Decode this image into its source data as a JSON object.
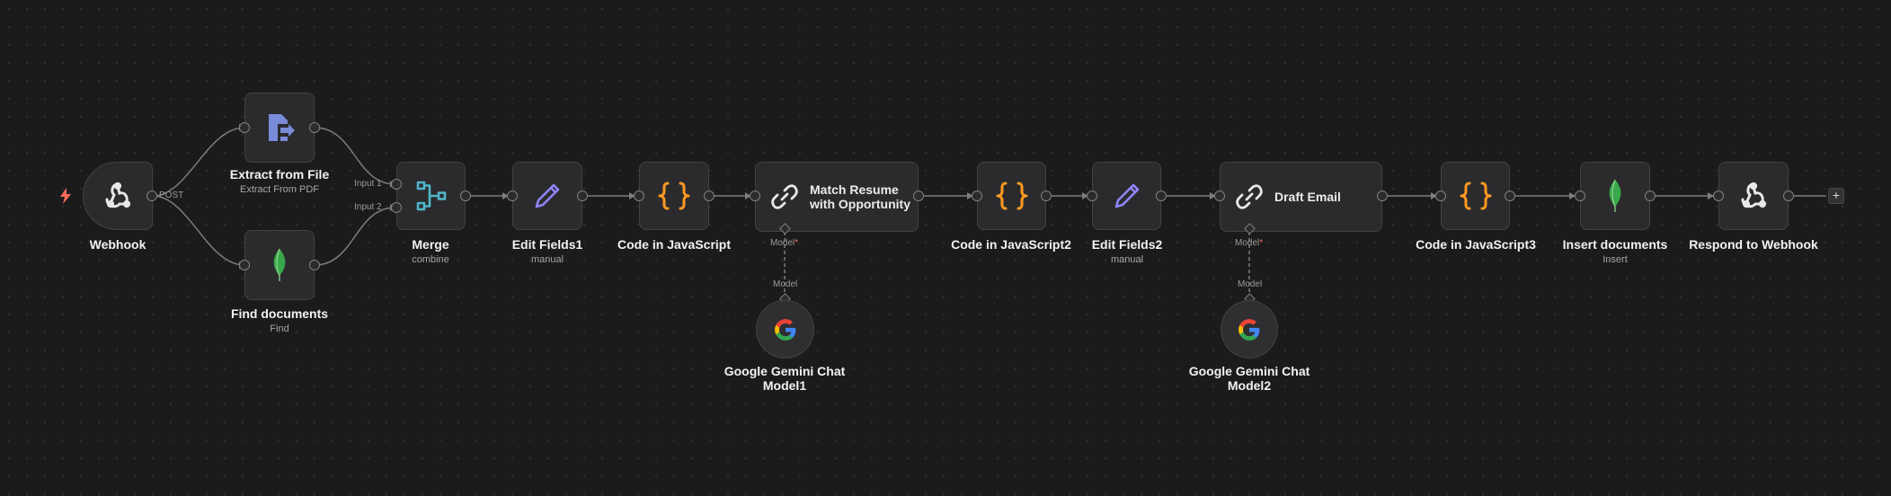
{
  "colors": {
    "background": "#1b1b1c",
    "node_fill": "#2b2b2d",
    "node_border": "#424244",
    "edge": "#7d7d80",
    "code_icon": "#ff9922",
    "edit_icon": "#8f86ff",
    "merge_icon": "#4fb6c9",
    "extract_icon": "#7a8bd9",
    "trigger_bolt": "#ff6d5a",
    "required_asterisk": "#ff6d6d"
  },
  "workflow": {
    "nodes": {
      "webhook": {
        "title": "Webhook",
        "icon": "webhook-icon"
      },
      "extract": {
        "title": "Extract from File",
        "subtitle": "Extract From PDF",
        "icon": "extract-file-icon"
      },
      "find": {
        "title": "Find documents",
        "subtitle": "Find",
        "icon": "mongodb-leaf-icon"
      },
      "merge": {
        "title": "Merge",
        "subtitle": "combine",
        "icon": "merge-icon"
      },
      "edit1": {
        "title": "Edit Fields1",
        "subtitle": "manual",
        "icon": "pencil-icon"
      },
      "code1": {
        "title": "Code in JavaScript",
        "icon": "code-braces-icon"
      },
      "match": {
        "title": "Match Resume\nwith Opportunity",
        "icon": "link-icon"
      },
      "gemini1": {
        "title": "Google Gemini Chat\nModel1",
        "icon": "google-g-icon"
      },
      "code2": {
        "title": "Code in JavaScript2",
        "icon": "code-braces-icon"
      },
      "edit2": {
        "title": "Edit Fields2",
        "subtitle": "manual",
        "icon": "pencil-icon"
      },
      "draft": {
        "title": "Draft Email",
        "icon": "link-icon"
      },
      "gemini2": {
        "title": "Google Gemini Chat\nModel2",
        "icon": "google-g-icon"
      },
      "code3": {
        "title": "Code in JavaScript3",
        "icon": "code-braces-icon"
      },
      "insert": {
        "title": "Insert documents",
        "subtitle": "Insert",
        "icon": "mongodb-leaf-icon"
      },
      "respond": {
        "title": "Respond to Webhook",
        "icon": "webhook-icon"
      }
    },
    "labels": {
      "post": "POST",
      "input1": "Input 1",
      "input2": "Input 2",
      "model_port": "Model",
      "model_port_required": "*",
      "model_out": "Model"
    },
    "add_button": "+"
  }
}
